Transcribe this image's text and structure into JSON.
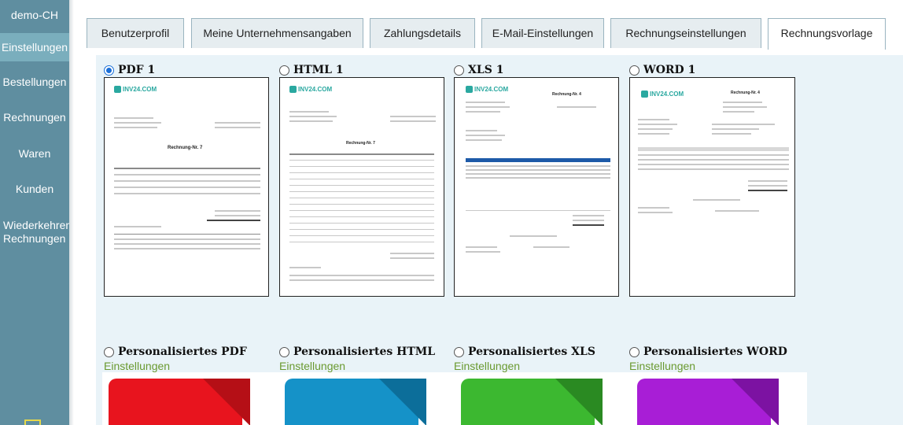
{
  "sidebar": {
    "brand": "demo-CH",
    "items": [
      {
        "label": "Einstellungen"
      },
      {
        "label": "Bestellungen"
      },
      {
        "label": "Rechnungen"
      },
      {
        "label": "Waren"
      },
      {
        "label": "Kunden"
      },
      {
        "label": "Wiederkehrende Rechnungen"
      }
    ]
  },
  "tabs": [
    {
      "label": "Benutzerprofil"
    },
    {
      "label": "Meine Unternehmensangaben"
    },
    {
      "label": "Zahlungsdetails"
    },
    {
      "label": "E-Mail-Einstellungen"
    },
    {
      "label": "Rechnungseinstellungen"
    },
    {
      "label": "Rechnungsvorlage"
    }
  ],
  "templates": [
    {
      "label": "PDF 1",
      "selected": true,
      "doc_title": "Rechnung-Nr. 7",
      "logo": "INV24.COM"
    },
    {
      "label": "HTML 1",
      "selected": false,
      "doc_title": "Rechnung-Nr. 7",
      "logo": "INV24.COM"
    },
    {
      "label": "XLS 1",
      "selected": false,
      "doc_title": "Rechnung-Nr. 4",
      "logo": "INV24.COM"
    },
    {
      "label": "WORD 1",
      "selected": false,
      "doc_title": "Rechnung-Nr. 4",
      "logo": "INV24.COM"
    }
  ],
  "custom": [
    {
      "label": "Personalisiertes PDF",
      "link": "Einstellungen",
      "color": "#e8141e",
      "fold": "#b50f16"
    },
    {
      "label": "Personalisiertes HTML",
      "link": "Einstellungen",
      "color": "#1592c8",
      "fold": "#0c6e9a"
    },
    {
      "label": "Personalisiertes XLS",
      "link": "Einstellungen",
      "color": "#3cb830",
      "fold": "#2a8a22"
    },
    {
      "label": "Personalisiertes WORD",
      "link": "Einstellungen",
      "color": "#a81ed6",
      "fold": "#7c12a2"
    }
  ],
  "colors": {
    "sidebar_bg": "#5f8ea0",
    "sidebar_active": "#7aaebd",
    "content_bg": "#e9f3f8",
    "link": "#6a9a30",
    "radio_selected": "#1a6fd8"
  }
}
